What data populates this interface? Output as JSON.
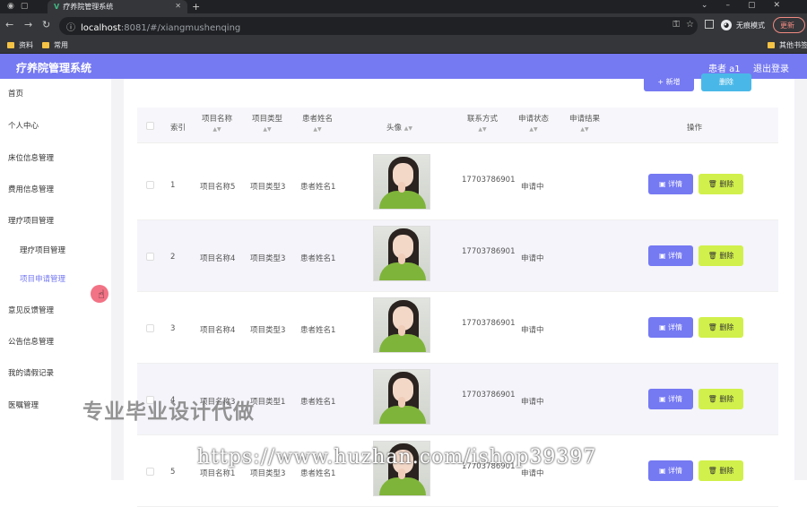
{
  "browser": {
    "tab_title": "疗养院管理系统",
    "url_host": "localhost",
    "url_path": ":8081/#/xiangmushenqing",
    "incognito_label": "无痕模式",
    "update_label": "更新",
    "bookmarks": [
      "资料",
      "常用",
      "其他书签"
    ]
  },
  "app": {
    "title": "疗养院管理系统",
    "user": "患者 a1",
    "logout": "退出登录"
  },
  "sidebar": {
    "items": [
      {
        "label": "首页"
      },
      {
        "label": "个人中心"
      },
      {
        "label": "床位信息管理"
      },
      {
        "label": "费用信息管理"
      },
      {
        "label": "理疗项目管理"
      },
      {
        "label": "理疗项目管理"
      },
      {
        "label": "项目申请管理"
      },
      {
        "label": "意见反馈管理"
      },
      {
        "label": "公告信息管理"
      },
      {
        "label": "我的请假记录"
      },
      {
        "label": "医嘱管理"
      }
    ]
  },
  "toolbar": {
    "add_label": "+ 新增",
    "delete_label": "删除"
  },
  "table": {
    "headers": {
      "index": "索引",
      "project_name": "项目名称",
      "project_type": "项目类型",
      "patient_name": "患者姓名",
      "avatar": "头像",
      "phone": "联系方式",
      "status": "申请状态",
      "result": "申请结果",
      "actions": "操作"
    },
    "rows": [
      {
        "index": "1",
        "project_name": "项目名称5",
        "project_type": "项目类型3",
        "patient_name": "患者姓名1",
        "phone": "17703786901",
        "status": "申请中",
        "result": ""
      },
      {
        "index": "2",
        "project_name": "项目名称4",
        "project_type": "项目类型3",
        "patient_name": "患者姓名1",
        "phone": "17703786901",
        "status": "申请中",
        "result": ""
      },
      {
        "index": "3",
        "project_name": "项目名称4",
        "project_type": "项目类型3",
        "patient_name": "患者姓名1",
        "phone": "17703786901",
        "status": "申请中",
        "result": ""
      },
      {
        "index": "4",
        "project_name": "项目名称3",
        "project_type": "项目类型1",
        "patient_name": "患者姓名1",
        "phone": "17703786901",
        "status": "申请中",
        "result": ""
      },
      {
        "index": "5",
        "project_name": "项目名称1",
        "project_type": "项目类型3",
        "patient_name": "患者姓名1",
        "phone": "17703786901",
        "status": "申请中",
        "result": ""
      }
    ],
    "detail_label": "详情",
    "delete_label": "删除"
  },
  "watermark": {
    "line1": "专业毕业设计代做",
    "line2": "https://www.huzhan.com/ishop39397"
  }
}
